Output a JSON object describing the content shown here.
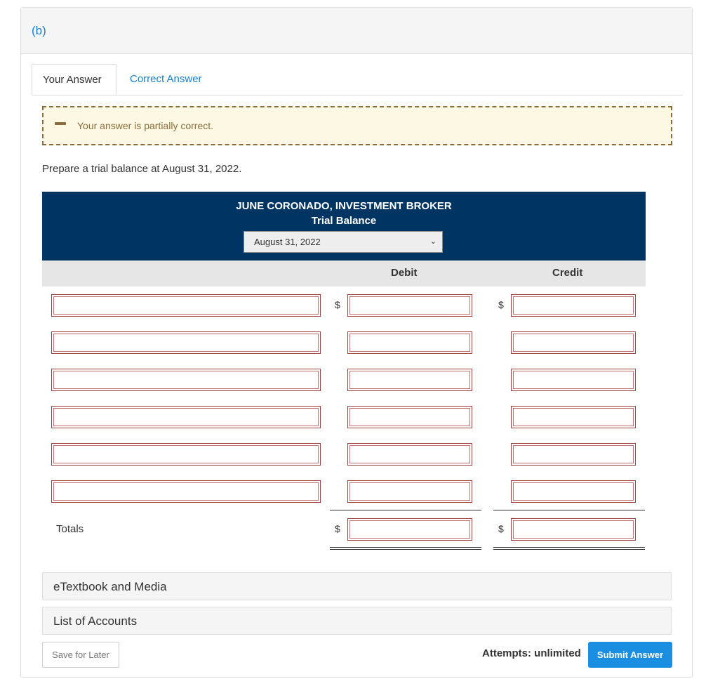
{
  "part": {
    "label": "(b)"
  },
  "tabs": [
    {
      "label": "Your Answer"
    },
    {
      "label": "Correct Answer"
    }
  ],
  "alert": {
    "icon": "minus-icon",
    "text": "Your answer is partially correct."
  },
  "prompt": "Prepare a trial balance at August 31, 2022.",
  "trial_balance": {
    "company": "JUNE CORONADO, INVESTMENT BROKER",
    "title": "Trial Balance",
    "date_selected": "August 31, 2022",
    "debit_header": "Debit",
    "credit_header": "Credit",
    "currency_symbol": "$",
    "totals_label": "Totals",
    "rows": [
      {
        "account": "",
        "debit": "",
        "credit": ""
      },
      {
        "account": "",
        "debit": "",
        "credit": ""
      },
      {
        "account": "",
        "debit": "",
        "credit": ""
      },
      {
        "account": "",
        "debit": "",
        "credit": ""
      },
      {
        "account": "",
        "debit": "",
        "credit": ""
      },
      {
        "account": "",
        "debit": "",
        "credit": ""
      }
    ],
    "totals": {
      "debit": "",
      "credit": ""
    }
  },
  "resources": [
    {
      "label": "eTextbook and Media"
    },
    {
      "label": "List of Accounts"
    }
  ],
  "footer": {
    "save_label": "Save for Later",
    "attempts_text": "Attempts: unlimited",
    "submit_label": "Submit Answer"
  },
  "colors": {
    "accent": "#1a7fcc",
    "header_bg": "#003462",
    "alert_bg": "#fcf8e3",
    "alert_fg": "#8a6d3b",
    "submit_bg": "#1a8ee0",
    "input_border": "#a04040"
  }
}
